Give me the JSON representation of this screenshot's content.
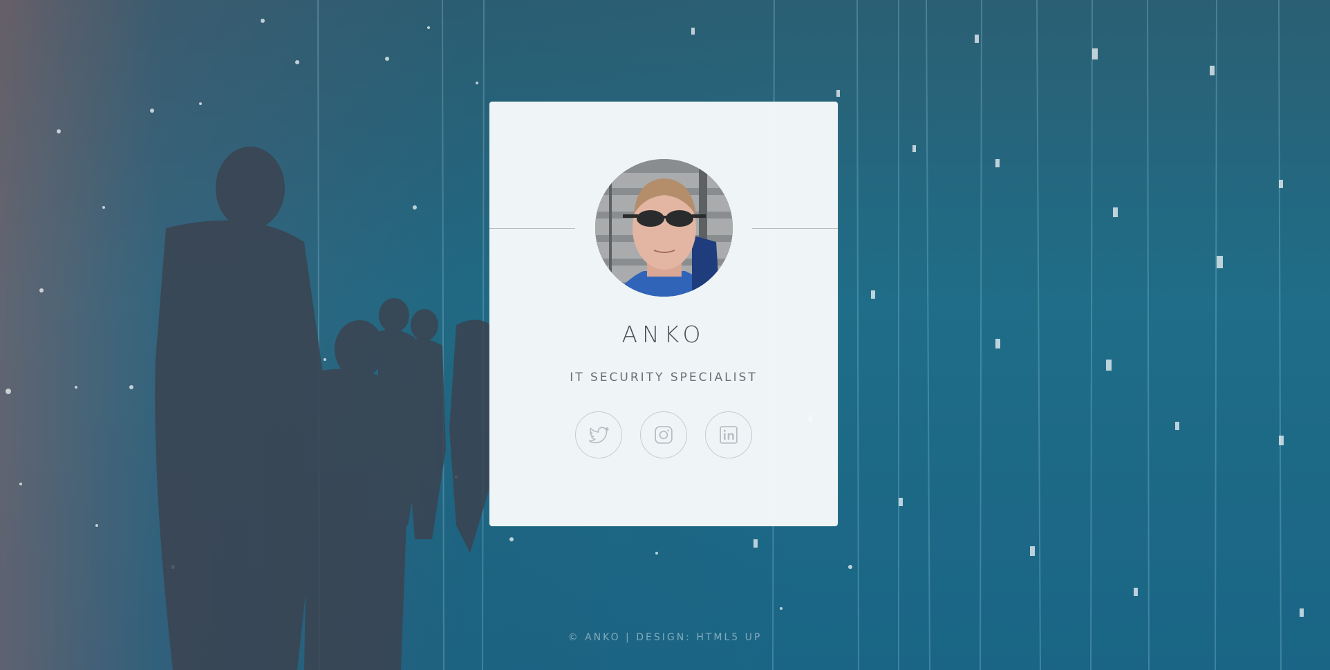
{
  "profile": {
    "name": "ANKO",
    "title": "IT SECURITY SPECIALIST",
    "avatar_alt": "Profile photo"
  },
  "social": [
    {
      "icon": "twitter-icon",
      "label": "Twitter"
    },
    {
      "icon": "instagram-icon",
      "label": "Instagram"
    },
    {
      "icon": "linkedin-icon",
      "label": "LinkedIn"
    }
  ],
  "footer": {
    "text": "© ANKO | DESIGN: HTML5 UP"
  },
  "colors": {
    "card_background": "#f8fafb",
    "text_primary": "#4a4f55",
    "icon_stroke": "#b8bdc2",
    "background_teal": "#1f6d88"
  }
}
